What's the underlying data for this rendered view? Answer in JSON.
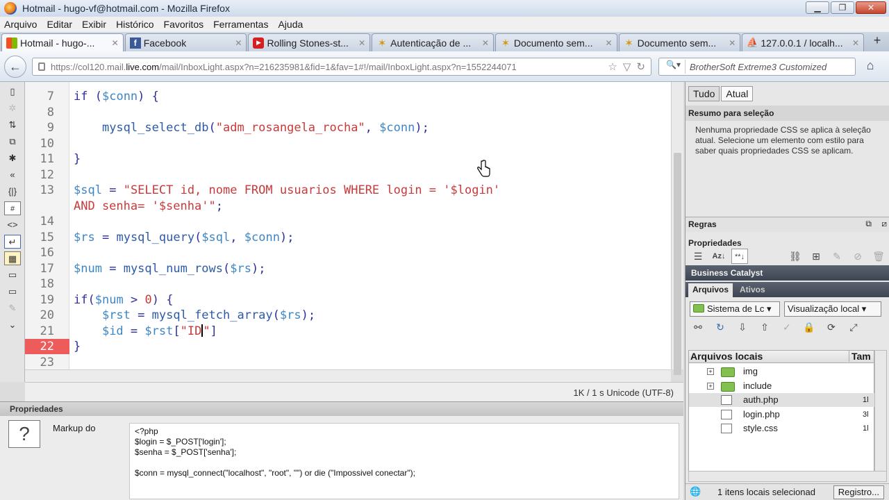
{
  "window": {
    "title": "Hotmail - hugo-vf@hotmail.com - Mozilla Firefox",
    "controls": {
      "minimize": "▁",
      "maximize": "❐",
      "close": "✕"
    }
  },
  "menu": [
    "Arquivo",
    "Editar",
    "Exibir",
    "Histórico",
    "Favoritos",
    "Ferramentas",
    "Ajuda"
  ],
  "tabs": [
    {
      "label": "Hotmail - hugo-...",
      "icon": "windows-live-icon",
      "active": true
    },
    {
      "label": "Facebook",
      "icon": "facebook-icon"
    },
    {
      "label": "Rolling Stones-st...",
      "icon": "youtube-icon"
    },
    {
      "label": "Autenticação de ...",
      "icon": "star-icon"
    },
    {
      "label": "Documento sem...",
      "icon": "star-icon"
    },
    {
      "label": "Documento sem...",
      "icon": "star-icon"
    },
    {
      "label": "127.0.0.1 / localh...",
      "icon": "phpmyadmin-icon"
    }
  ],
  "nav": {
    "url_prefix": "https://col120.mail.",
    "url_domain": "live.com",
    "url_rest": "/mail/InboxLight.aspx?n=216235981&fid=1&fav=1#!/mail/InboxLight.aspx?n=1552244071",
    "search_placeholder": "BrotherSoft Extreme3 Customized",
    "search_engine": "🔍▾"
  },
  "editor": {
    "error_line": 22,
    "lines": [
      {
        "n": "7",
        "html": "<span class='kw'>if</span> <span class='pun'>(</span><span class='var'>$conn</span><span class='pun'>)</span> <span class='pun'>{</span>"
      },
      {
        "n": "8",
        "html": ""
      },
      {
        "n": "9",
        "html": "    <span class='fn'>mysql_select_db</span><span class='pun'>(</span><span class='str'>\"adm_rosangela_rocha\"</span><span class='pun'>,</span> <span class='var'>$conn</span><span class='pun'>);</span>"
      },
      {
        "n": "10",
        "html": ""
      },
      {
        "n": "11",
        "html": "<span class='pun'>}</span>"
      },
      {
        "n": "12",
        "html": ""
      },
      {
        "n": "13",
        "html": "<span class='var'>$sql</span> <span class='pun'>=</span> <span class='str'>\"SELECT id, nome FROM usuarios WHERE login = '$login'</span>"
      },
      {
        "n": "",
        "html": "<span class='str'>AND senha= '$senha'\"</span><span class='pun'>;</span>"
      },
      {
        "n": "14",
        "html": ""
      },
      {
        "n": "15",
        "html": "<span class='var'>$rs</span> <span class='pun'>=</span> <span class='fn'>mysql_query</span><span class='pun'>(</span><span class='var'>$sql</span><span class='pun'>,</span> <span class='var'>$conn</span><span class='pun'>);</span>"
      },
      {
        "n": "16",
        "html": ""
      },
      {
        "n": "17",
        "html": "<span class='var'>$num</span> <span class='pun'>=</span> <span class='fn'>mysql_num_rows</span><span class='pun'>(</span><span class='var'>$rs</span><span class='pun'>);</span>"
      },
      {
        "n": "18",
        "html": ""
      },
      {
        "n": "19",
        "html": "<span class='kw'>if</span><span class='pun'>(</span><span class='var'>$num</span> <span class='pun'>&gt;</span> <span class='str'>0</span><span class='pun'>)</span> <span class='pun'>{</span>"
      },
      {
        "n": "20",
        "html": "    <span class='var'>$rst</span> <span class='pun'>=</span> <span class='fn'>mysql_fetch_array</span><span class='pun'>(</span><span class='var'>$rs</span><span class='pun'>);</span>"
      },
      {
        "n": "21",
        "html": "    <span class='var'>$id</span> <span class='pun'>=</span> <span class='var'>$rst</span><span class='pun'>[</span><span class='str'>\"ID</span><span class='caret'></span><span class='str'>\"</span><span class='pun'>]</span>"
      },
      {
        "n": "22",
        "html": "<span class='pun'>}</span>"
      },
      {
        "n": "23",
        "html": ""
      }
    ]
  },
  "status": {
    "text": "1K / 1 s   Unicode (UTF-8)"
  },
  "properties": {
    "header": "Propriedades",
    "markup_label": "Markup do",
    "markup_code": "<?php\n$login = $_POST['login'];\n$senha = $_POST['senha'];\n\n$conn = mysql_connect(\"localhost\", \"root\", \"\") or die (\"Impossivel conectar\");"
  },
  "css_panel": {
    "tab_all": "Tudo",
    "tab_current": "Atual",
    "summary_title": "Resumo para seleção",
    "summary_text": "Nenhuma propriedade CSS se aplica à seleção atual. Selecione um elemento com estilo para saber quais propriedades CSS se aplicam.",
    "rules": "Regras",
    "properties": "Propriedades"
  },
  "business_catalyst": "Business Catalyst",
  "files_panel": {
    "tab_files": "Arquivos",
    "tab_assets": "Ativos",
    "site_select": "Sistema de Lc",
    "view_select": "Visualização local",
    "col_name": "Arquivos locais",
    "col_size": "Tam",
    "items": [
      {
        "name": "img",
        "type": "folder",
        "size": ""
      },
      {
        "name": "include",
        "type": "folder",
        "size": ""
      },
      {
        "name": "auth.php",
        "type": "file",
        "size": "1l",
        "selected": true
      },
      {
        "name": "login.php",
        "type": "file",
        "size": "3l"
      },
      {
        "name": "style.css",
        "type": "file",
        "size": "1l"
      }
    ],
    "status": "1 itens locais selecionad",
    "register_btn": "Registro..."
  }
}
